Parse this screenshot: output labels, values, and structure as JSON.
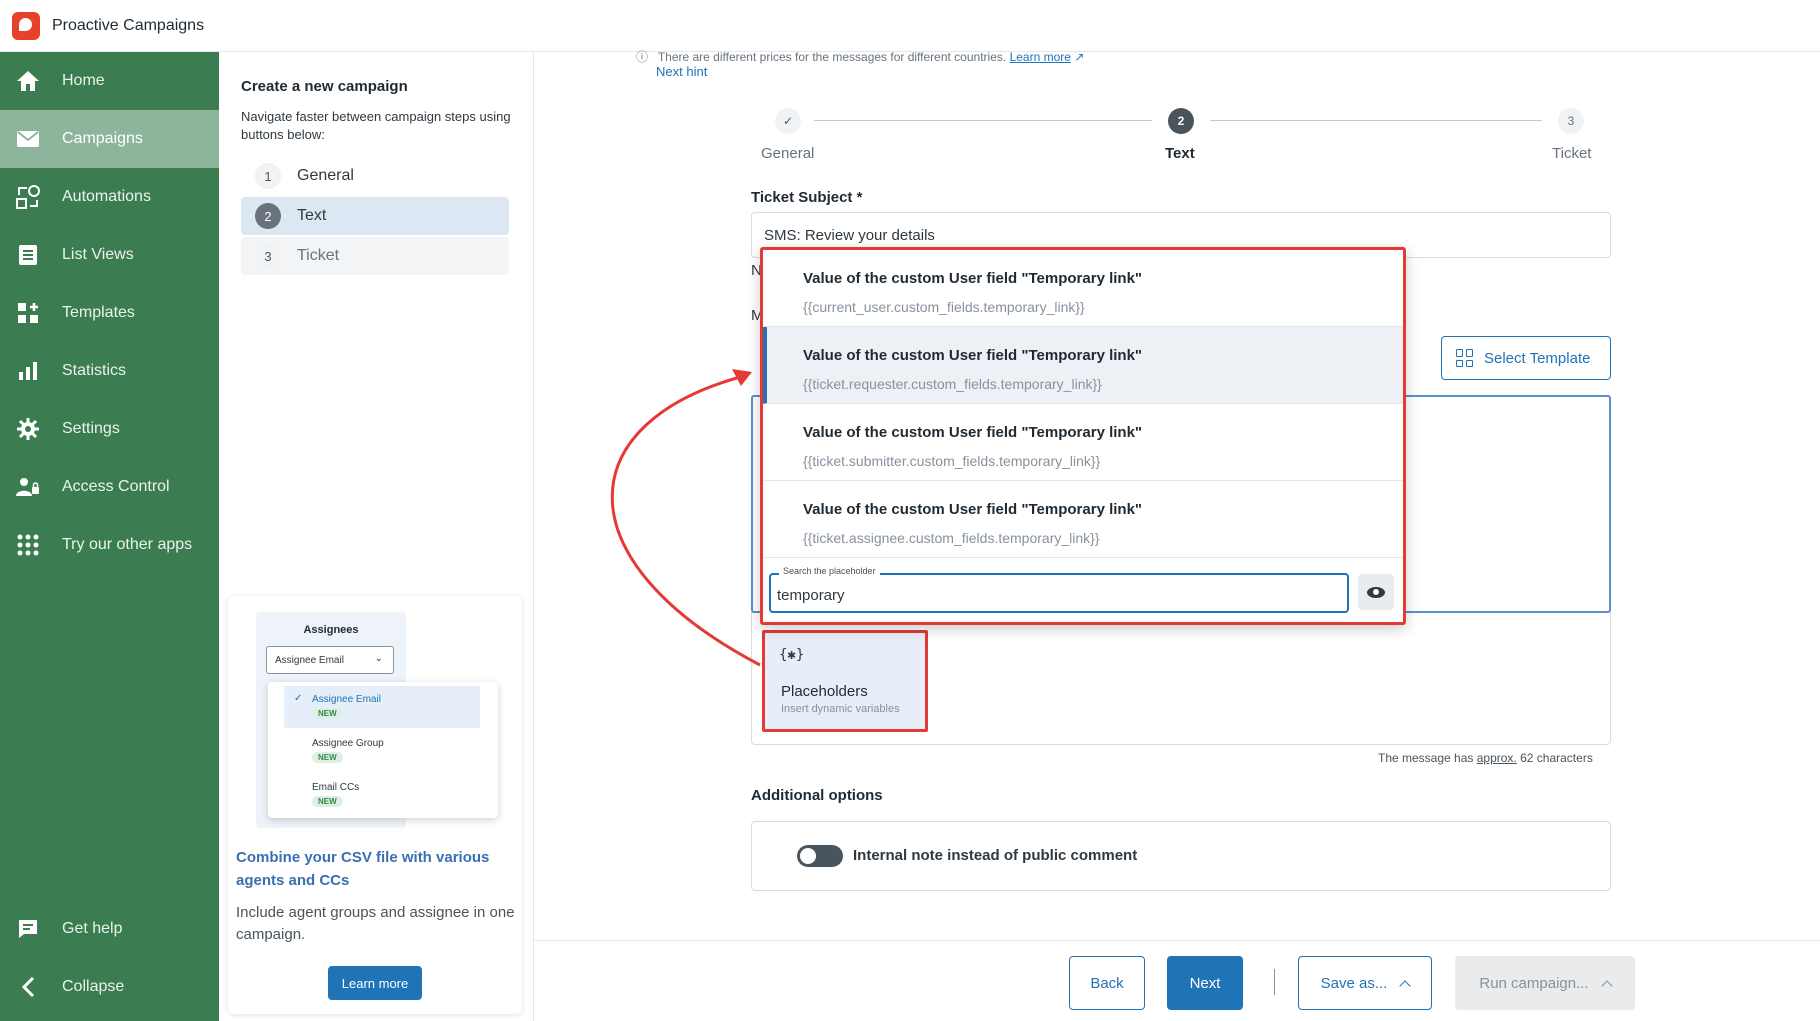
{
  "app": {
    "title": "Proactive Campaigns"
  },
  "nav": {
    "items": [
      {
        "label": "Home",
        "icon": "home-icon"
      },
      {
        "label": "Campaigns",
        "icon": "mail-icon",
        "active": true
      },
      {
        "label": "Automations",
        "icon": "automations-icon"
      },
      {
        "label": "List Views",
        "icon": "list-icon"
      },
      {
        "label": "Templates",
        "icon": "templates-icon"
      },
      {
        "label": "Statistics",
        "icon": "bar-chart-icon"
      },
      {
        "label": "Settings",
        "icon": "gear-icon"
      },
      {
        "label": "Access Control",
        "icon": "user-lock-icon"
      },
      {
        "label": "Try our other apps",
        "icon": "apps-grid-icon"
      }
    ],
    "get_help": "Get help",
    "collapse": "Collapse"
  },
  "steps_panel": {
    "title": "Create a new campaign",
    "description": "Navigate faster between campaign steps using buttons below:",
    "steps": [
      {
        "num": "1",
        "label": "General"
      },
      {
        "num": "2",
        "label": "Text"
      },
      {
        "num": "3",
        "label": "Ticket"
      }
    ]
  },
  "promo": {
    "illustration": {
      "title": "Assignees",
      "select_value": "Assignee Email",
      "options": [
        "Assignee Email",
        "Assignee Group",
        "Email CCs"
      ],
      "badge": "NEW"
    },
    "heading": "Combine your CSV file with various agents and CCs",
    "text": "Include agent groups and assignee in one campaign.",
    "button": "Learn more"
  },
  "hint": {
    "text": "There are different prices for the messages for different countries.",
    "learn_more": "Learn more",
    "next_hint": "Next hint"
  },
  "stepper": {
    "steps": [
      {
        "num": "✓",
        "label": "General",
        "state": "done"
      },
      {
        "num": "2",
        "label": "Text",
        "state": "current"
      },
      {
        "num": "3",
        "label": "Ticket",
        "state": "todo"
      }
    ]
  },
  "ticket_subject": {
    "label": "Ticket Subject *",
    "value": "SMS: Review your details"
  },
  "select_template": "Select Template",
  "placeholders_button": {
    "icon": "{✱}",
    "title": "Placeholders",
    "subtitle": "Insert dynamic variables"
  },
  "char_count": {
    "prefix": "The message has",
    "approx": "approx.",
    "suffix": "62 characters"
  },
  "additional_options": {
    "title": "Additional options",
    "toggle_label": "Internal note instead of public comment"
  },
  "footer": {
    "back": "Back",
    "next": "Next",
    "save_as": "Save as...",
    "run_campaign": "Run campaign..."
  },
  "dropdown": {
    "items": [
      {
        "title": "Value of the custom User field \"Temporary link\"",
        "code": "{{current_user.custom_fields.temporary_link}}"
      },
      {
        "title": "Value of the custom User field \"Temporary link\"",
        "code": "{{ticket.requester.custom_fields.temporary_link}}",
        "selected": true
      },
      {
        "title": "Value of the custom User field \"Temporary link\"",
        "code": "{{ticket.submitter.custom_fields.temporary_link}}"
      },
      {
        "title": "Value of the custom User field \"Temporary link\"",
        "code": "{{ticket.assignee.custom_fields.temporary_link}}"
      }
    ],
    "search_label": "Search the placeholder",
    "search_value": "temporary"
  },
  "colors": {
    "nav_bg": "#3b7d50",
    "nav_active": "#8db59b",
    "primary": "#1f73b7",
    "annotation_red": "#e53935"
  }
}
